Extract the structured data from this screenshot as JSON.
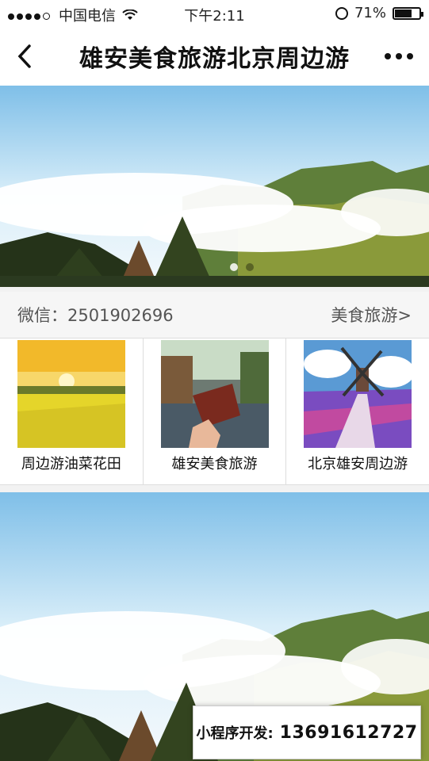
{
  "status_bar": {
    "carrier": "中国电信",
    "time": "下午2:11",
    "battery": "71%",
    "battery_level": 0.71
  },
  "nav": {
    "title": "雄安美食旅游北京周边游",
    "back_icon": "chevron-left-icon",
    "more_icon": "more-dots-icon"
  },
  "info": {
    "wechat": "微信：2501902696",
    "link": "美食旅游>"
  },
  "categories": [
    {
      "label": "周边游油菜花田"
    },
    {
      "label": "雄安美食旅游"
    },
    {
      "label": "北京雄安周边游"
    }
  ],
  "contact": {
    "label": "小程序开发:",
    "phone": "13691612727"
  },
  "colors": {
    "sky": "#8cc7ee",
    "cloud": "#ffffff",
    "mountain": "#6b8a3c"
  }
}
